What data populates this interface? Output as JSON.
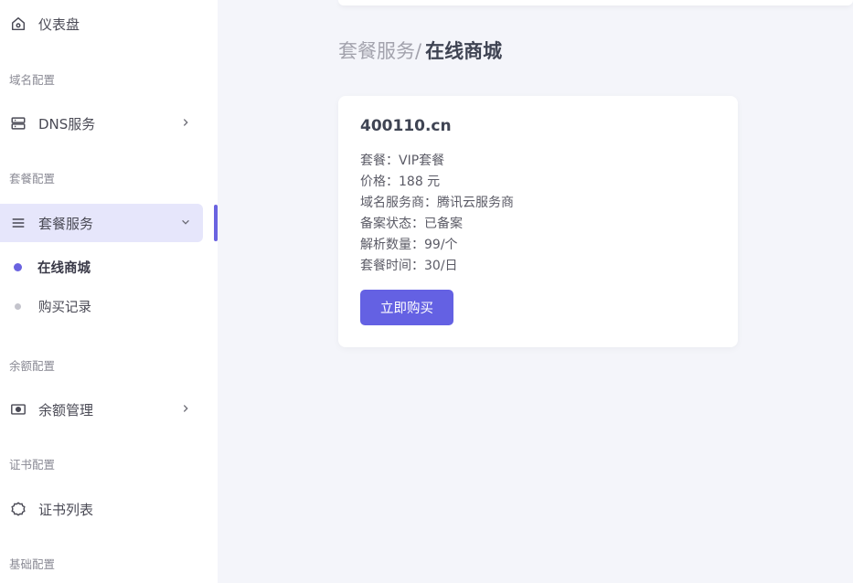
{
  "sidebar": {
    "dashboard": {
      "label": "仪表盘",
      "icon": "home-icon"
    },
    "sections": {
      "domain": "域名配置",
      "package": "套餐配置",
      "balance": "余额配置",
      "cert": "证书配置",
      "basic": "基础配置"
    },
    "dns": {
      "label": "DNS服务",
      "icon": "server-icon"
    },
    "package_service": {
      "label": "套餐服务",
      "icon": "menu-icon",
      "expanded": true
    },
    "package_sub": [
      {
        "label": "在线商城",
        "active": true
      },
      {
        "label": "购买记录",
        "active": false
      }
    ],
    "balance_mgmt": {
      "label": "余额管理",
      "icon": "cash-icon"
    },
    "cert_list": {
      "label": "证书列表",
      "icon": "certificate-icon"
    }
  },
  "breadcrumb": {
    "parent": "套餐服务",
    "separator": "/",
    "current": "在线商城"
  },
  "product": {
    "title": "400110.cn",
    "details": [
      "套餐：VIP套餐",
      "价格：188 元",
      "域名服务商：腾讯云服务商",
      "备案状态：已备案",
      "解析数量：99/个",
      "套餐时间：30/日"
    ],
    "buy_label": "立即购买"
  },
  "colors": {
    "accent": "#6461e3",
    "active_bg": "#e6e6fb",
    "page_bg": "#f4f5fa"
  }
}
